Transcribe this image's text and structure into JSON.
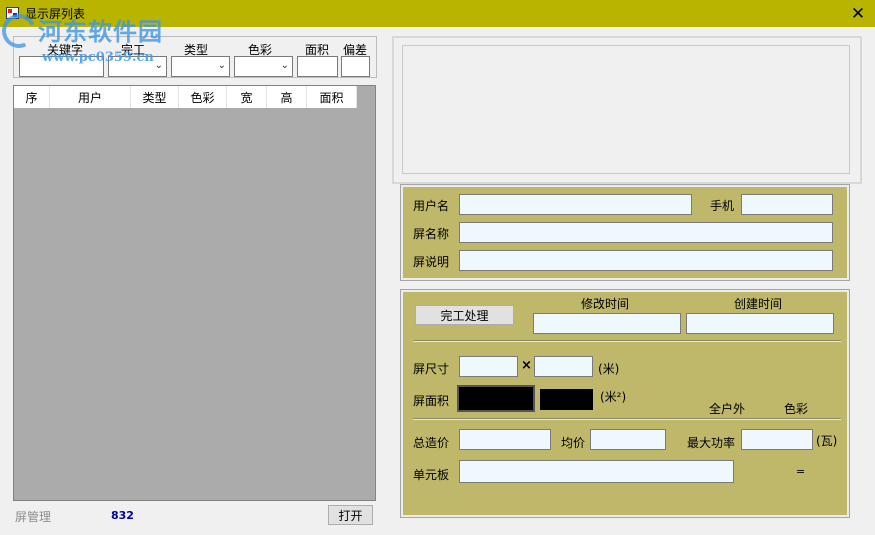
{
  "window": {
    "title": "显示屏列表",
    "close_symbol": "✕"
  },
  "watermark": {
    "site_name": "河东软件园",
    "url": "www.pc0359.cn"
  },
  "filter": {
    "keyword_label": "关键字",
    "done_label": "完工",
    "type_label": "类型",
    "color_label": "色彩",
    "area_label": "面积",
    "tolerance_label": "偏差",
    "keyword_value": "",
    "area_value": "",
    "tolerance_value": ""
  },
  "list": {
    "columns": [
      "序",
      "用户",
      "类型",
      "色彩",
      "宽",
      "高",
      "面积"
    ]
  },
  "status": {
    "label": "屏管理",
    "count": "832",
    "open_button": "打开"
  },
  "info": {
    "username_label": "用户名",
    "phone_label": "手机",
    "screen_name_label": "屏名称",
    "screen_desc_label": "屏说明",
    "username_value": "",
    "phone_value": "",
    "screen_name_value": "",
    "screen_desc_value": ""
  },
  "details": {
    "complete_button": "完工处理",
    "modified_time_label": "修改时间",
    "created_time_label": "创建时间",
    "size_label": "屏尺寸",
    "times_symbol": "×",
    "size_unit": "(米)",
    "area_label": "屏面积",
    "area_unit": "(米²)",
    "full_outdoor_label": "全户外",
    "color_label": "色彩",
    "total_cost_label": "总造价",
    "unit_price_label": "均价",
    "max_power_label": "最大功率",
    "power_unit": "(瓦)",
    "module_label": "单元板",
    "equals_symbol": "="
  },
  "colors": {
    "title_bar": "#b9b400",
    "panel_olive": "#bfb76a",
    "list_gray": "#ababab",
    "input_bg": "#f0f8ff",
    "count_blue": "#0000a0"
  }
}
